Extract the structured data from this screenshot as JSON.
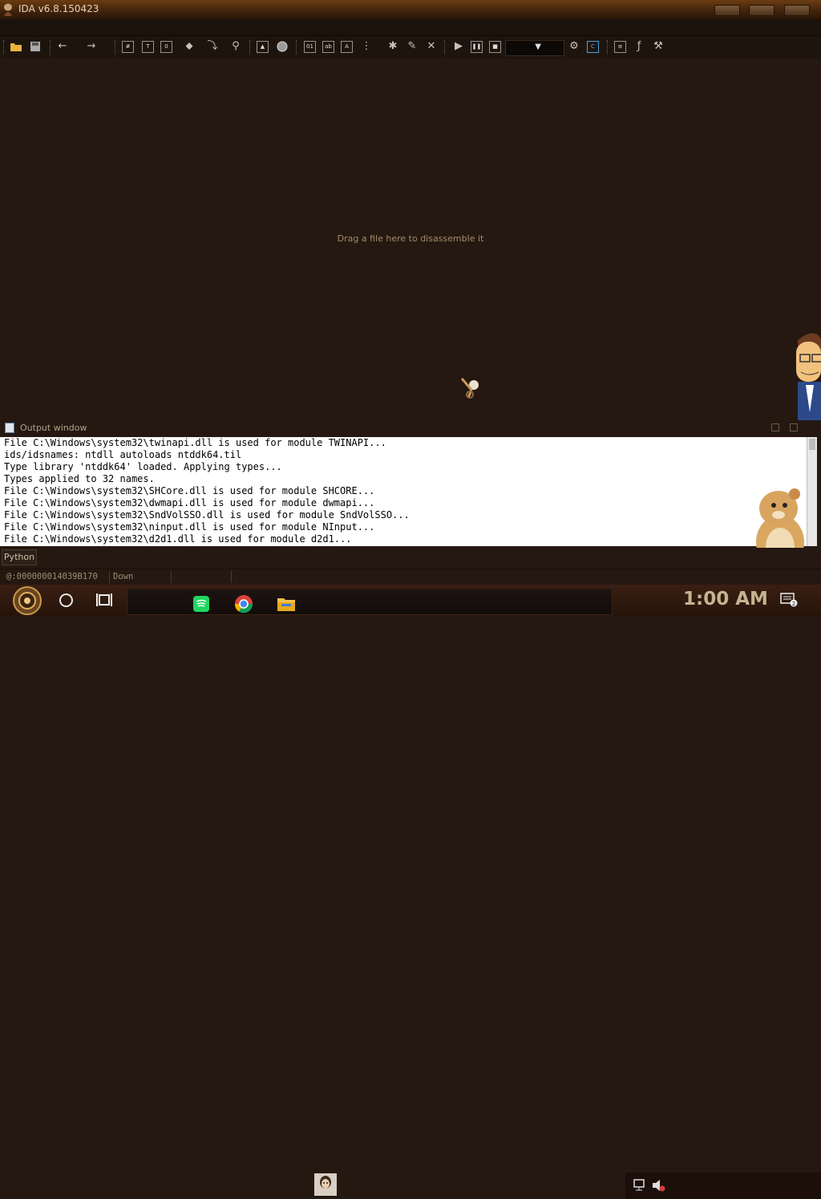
{
  "window": {
    "title": "IDA v6.8.150423"
  },
  "toolbar": {
    "buttons": [
      "open-icon",
      "save-icon",
      "back-icon",
      "forward-icon",
      "code-icon",
      "text-icon",
      "data-icon",
      "unknown-icon",
      "jump-icon",
      "search-icon",
      "warning-icon",
      "record-icon",
      "bytes-icon",
      "string-icon",
      "ascii-icon",
      "struct-icon",
      "ptr-icon",
      "edit-icon",
      "delete-icon",
      "play-icon",
      "pause-icon",
      "stop-icon",
      "debugger-icon",
      "c-icon",
      "cplus-icon",
      "graph-icon",
      "func-icon",
      "tools-icon"
    ],
    "debugger_select": ""
  },
  "main": {
    "drag_hint": "Drag a file here to disassemble it"
  },
  "output": {
    "title": "Output window",
    "lines": [
      "File C:\\Windows\\system32\\twinapi.dll is used for module TWINAPI...",
      "ids/idsnames: ntdll autoloads ntddk64.til",
      "Type library 'ntddk64' loaded. Applying types...",
      "Types applied to 32 names.",
      "File C:\\Windows\\system32\\SHCore.dll is used for module SHCORE...",
      "File C:\\Windows\\system32\\dwmapi.dll is used for module dwmapi...",
      "File C:\\Windows\\system32\\SndVolSSO.dll is used for module SndVolSSO...",
      "File C:\\Windows\\system32\\ninput.dll is used for module NInput...",
      "File C:\\Windows\\system32\\d2d1.dll is used for module d2d1..."
    ]
  },
  "python": {
    "label": "Python"
  },
  "status": {
    "address": "@:000000014039B170",
    "direction": "Down"
  },
  "taskbar": {
    "apps": [
      "spotify-icon",
      "chrome-icon",
      "file-explorer-icon",
      "ida-icon"
    ],
    "clock": "1:00 AM"
  },
  "colors": {
    "background": "#241811",
    "text_hint": "#a68b6a",
    "output_bg": "#ffffff"
  }
}
